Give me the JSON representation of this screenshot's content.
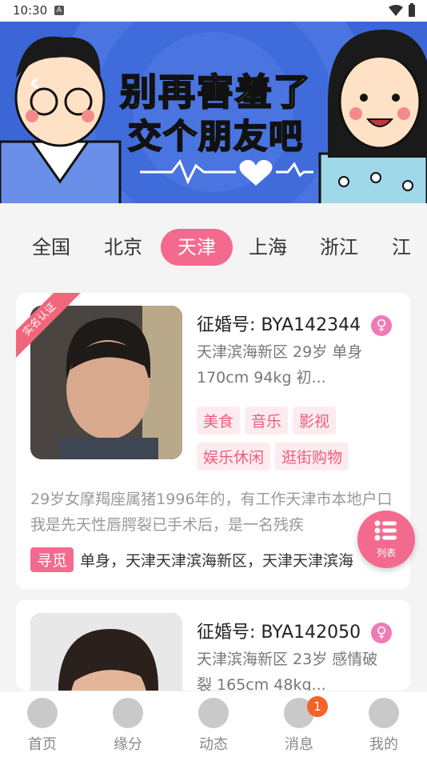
{
  "status": {
    "time": "10:30",
    "a_icon": "A"
  },
  "banner": {
    "line1": "别再害羞了",
    "line2": "交个朋友吧"
  },
  "tabs": [
    "全国",
    "北京",
    "天津",
    "上海",
    "浙江",
    "江"
  ],
  "cards": [
    {
      "ribbon": "实名认证",
      "id_label": "征婚号:",
      "id": "BYA142344",
      "gender_symbol": "♀",
      "info": "天津滨海新区  29岁  单身  170cm  94kg  初...",
      "tags": [
        "美食",
        "音乐",
        "影视",
        "娱乐休闲",
        "逛街购物"
      ],
      "intro": "29岁女摩羯座属猪1996年的，有工作天津市本地户口我是先天性唇腭裂已手术后，是一名残疾",
      "seek_badge": "寻觅",
      "seek": "单身，天津天津滨海新区，天津天津滨海"
    },
    {
      "id_label": "征婚号:",
      "id": "BYA142050",
      "gender_symbol": "♀",
      "info": "天津滨海新区  23岁  感情破裂  165cm  48kg..."
    }
  ],
  "float_button": {
    "label": "列表"
  },
  "bottom_nav": [
    {
      "label": "首页"
    },
    {
      "label": "缘分"
    },
    {
      "label": "动态"
    },
    {
      "label": "消息",
      "badge": "1"
    },
    {
      "label": "我的"
    }
  ]
}
